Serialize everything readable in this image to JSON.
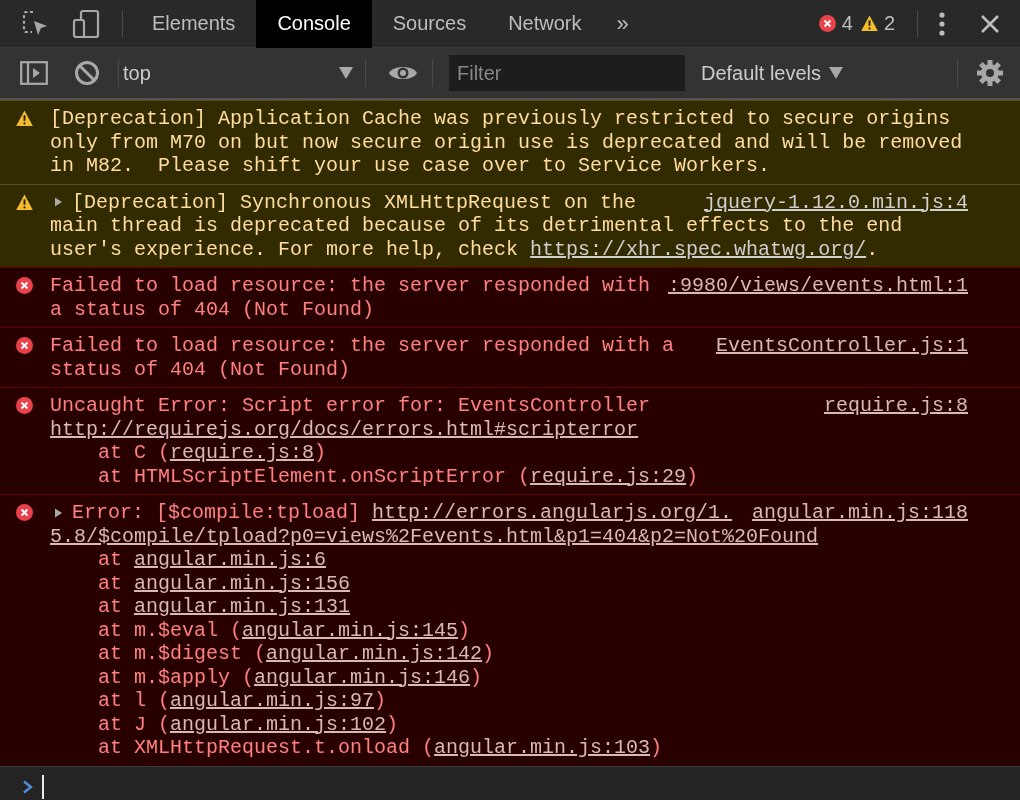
{
  "tabs": [
    {
      "label": "Elements",
      "selected": false
    },
    {
      "label": "Console",
      "selected": true
    },
    {
      "label": "Sources",
      "selected": false
    },
    {
      "label": "Network",
      "selected": false
    }
  ],
  "more_tabs": "»",
  "counts": {
    "errors": "4",
    "warnings": "2"
  },
  "console_toolbar": {
    "context": "top",
    "filter": {
      "placeholder": "Filter"
    },
    "levels": "Default levels"
  },
  "messages": [
    {
      "kind": "warning",
      "expandable": false,
      "lines": [
        [
          {
            "text": "[Deprecation] Application Cache was previously restricted to secure origins"
          }
        ],
        [
          {
            "text": "only from M70 on but now secure origin use is deprecated and will be removed"
          }
        ],
        [
          {
            "text": "in M82.  Please shift your use case over to Service Workers."
          }
        ]
      ]
    },
    {
      "kind": "warning",
      "expandable": true,
      "source": "jquery-1.12.0.min.js:4",
      "lines": [
        [
          {
            "text": "[Deprecation] Synchronous XMLHttpRequest on the"
          }
        ],
        [
          {
            "text": "main thread is deprecated because of its detrimental effects to the end"
          }
        ],
        [
          {
            "text": "user's experience. For more help, check "
          },
          {
            "link": "https://xhr.spec.whatwg.org/"
          },
          {
            "text": "."
          }
        ]
      ]
    },
    {
      "kind": "error",
      "expandable": false,
      "source": ":9980/views/events.html:1",
      "lines": [
        [
          {
            "text": "Failed to load resource: the server responded with"
          }
        ],
        [
          {
            "text": "a status of 404 (Not Found)"
          }
        ]
      ]
    },
    {
      "kind": "error",
      "expandable": false,
      "source": "EventsController.js:1",
      "lines": [
        [
          {
            "text": "Failed to load resource: the server responded with a"
          }
        ],
        [
          {
            "text": "status of 404 (Not Found)"
          }
        ]
      ]
    },
    {
      "kind": "error",
      "expandable": false,
      "source": "require.js:8",
      "lines": [
        [
          {
            "text": "Uncaught Error: Script error for: EventsController"
          }
        ],
        [
          {
            "link": "http://requirejs.org/docs/errors.html#scripterror"
          }
        ]
      ],
      "stack": [
        {
          "prefix": "at C (",
          "link": "require.js:8",
          "suffix": ")"
        },
        {
          "prefix": "at HTMLScriptElement.onScriptError (",
          "link": "require.js:29",
          "suffix": ")"
        }
      ]
    },
    {
      "kind": "error",
      "expandable": true,
      "source": "angular.min.js:118",
      "lines": [
        [
          {
            "text": "Error: [$compile:tpload] "
          },
          {
            "link": "http://errors.angularjs.org/1."
          }
        ],
        [
          {
            "link": "5.8/$compile/tpload?p0=views%2Fevents.html&p1=404&p2=Not%20Found"
          }
        ]
      ],
      "stack": [
        {
          "prefix": "at ",
          "link": "angular.min.js:6"
        },
        {
          "prefix": "at ",
          "link": "angular.min.js:156"
        },
        {
          "prefix": "at ",
          "link": "angular.min.js:131"
        },
        {
          "prefix": "at m.$eval (",
          "link": "angular.min.js:145",
          "suffix": ")"
        },
        {
          "prefix": "at m.$digest (",
          "link": "angular.min.js:142",
          "suffix": ")"
        },
        {
          "prefix": "at m.$apply (",
          "link": "angular.min.js:146",
          "suffix": ")"
        },
        {
          "prefix": "at l (",
          "link": "angular.min.js:97",
          "suffix": ")"
        },
        {
          "prefix": "at J (",
          "link": "angular.min.js:102",
          "suffix": ")"
        },
        {
          "prefix": "at XMLHttpRequest.t.onload (",
          "link": "angular.min.js:103",
          "suffix": ")"
        }
      ]
    }
  ]
}
